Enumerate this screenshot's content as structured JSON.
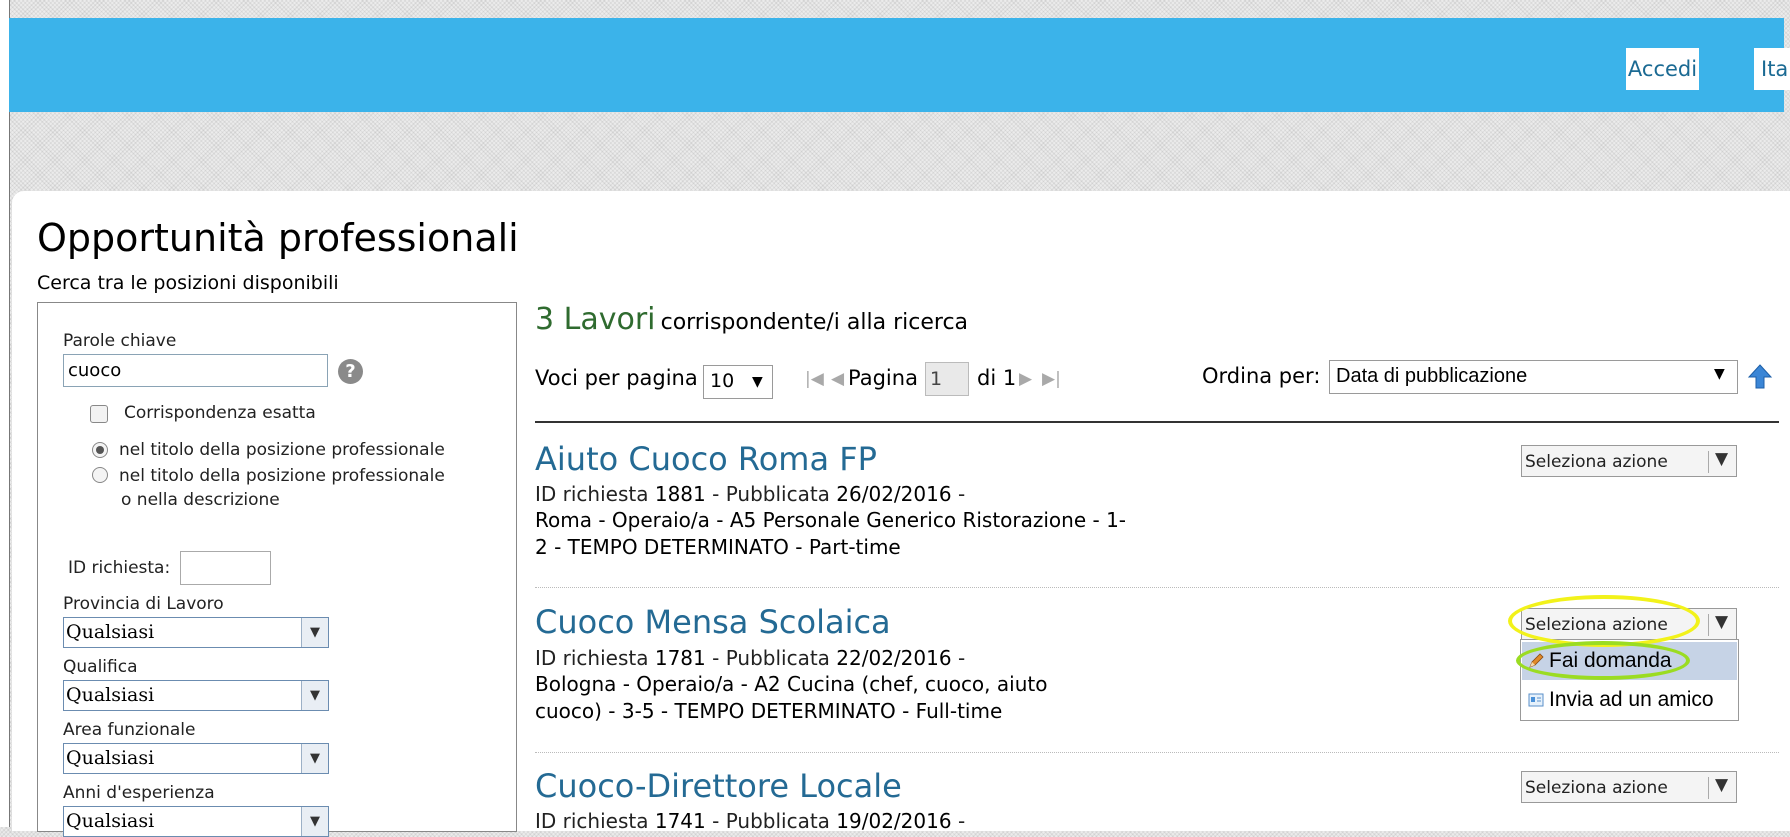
{
  "header": {
    "login_label": "Accedi",
    "language_label": "Ita"
  },
  "page": {
    "title": "Opportunità professionali",
    "subtitle": "Cerca tra le posizioni disponibili"
  },
  "filters": {
    "keywords_label": "Parole chiave",
    "keywords_value": "cuoco",
    "help_glyph": "?",
    "exact_match_label": "Corrispondenza esatta",
    "scope_title_label": "nel titolo della posizione professionale",
    "scope_title_desc_label_1": "nel titolo della posizione professionale",
    "scope_title_desc_label_2": "o nella descrizione",
    "request_id_label": "ID richiesta:",
    "province_label": "Provincia di Lavoro",
    "province_value": "Qualsiasi",
    "qualification_label": "Qualifica",
    "qualification_value": "Qualsiasi",
    "area_label": "Area funzionale",
    "area_value": "Qualsiasi",
    "experience_label": "Anni d'esperienza",
    "experience_value": "Qualsiasi"
  },
  "results": {
    "count": "3 Lavori",
    "count_suffix": "corrispondente/i alla ricerca",
    "per_page_label": "Voci per pagina",
    "per_page_value": "10",
    "page_label": "Pagina",
    "page_value": "1",
    "page_total_label": "di 1",
    "sort_label": "Ordina per:",
    "sort_value": "Data di pubblicazione"
  },
  "jobs": [
    {
      "title": "Aiuto Cuoco Roma FP",
      "id_label": "ID richiesta",
      "id": "1881",
      "published_label": "- Pubblicata",
      "date": "26/02/2016",
      "trailing": "-",
      "details_line1": "Roma  -  Operaio/a  -  A5 Personale Generico Ristorazione  -  1-",
      "details_line2": "2  -  TEMPO DETERMINATO  -  Part-time",
      "action_label": "Seleziona azione"
    },
    {
      "title": "Cuoco Mensa Scolaica",
      "id_label": "ID richiesta",
      "id": "1781",
      "published_label": "- Pubblicata",
      "date": "22/02/2016",
      "trailing": "-",
      "details_line1": "Bologna  -  Operaio/a  -  A2 Cucina (chef, cuoco, aiuto",
      "details_line2": "cuoco)  -  3-5  -  TEMPO DETERMINATO  -  Full-time",
      "action_label": "Seleziona azione"
    },
    {
      "title": "Cuoco-Direttore Locale",
      "id_label": "ID richiesta",
      "id": "1741",
      "published_label": "- Pubblicata",
      "date": "19/02/2016",
      "trailing": "-",
      "action_label": "Seleziona azione"
    }
  ],
  "action_menu": {
    "apply_label": "Fai domanda",
    "send_friend_label": "Invia ad un amico"
  },
  "colors": {
    "header_blue": "#3bb3ea",
    "link_blue": "#246a94",
    "count_green": "#2f6b2f",
    "highlight_yellow": "#f2f21a",
    "highlight_green": "#9bdc22",
    "menu_highlight": "#c6d3e6"
  },
  "icons": {
    "help": "help-icon",
    "sort_direction": "arrow-up-icon",
    "apply": "pencil-icon",
    "send_friend": "envelope-card-icon",
    "dropdown": "chevron-down-icon",
    "first_page": "first-page-icon",
    "prev_page": "prev-page-icon",
    "next_page": "next-page-icon",
    "last_page": "last-page-icon"
  }
}
